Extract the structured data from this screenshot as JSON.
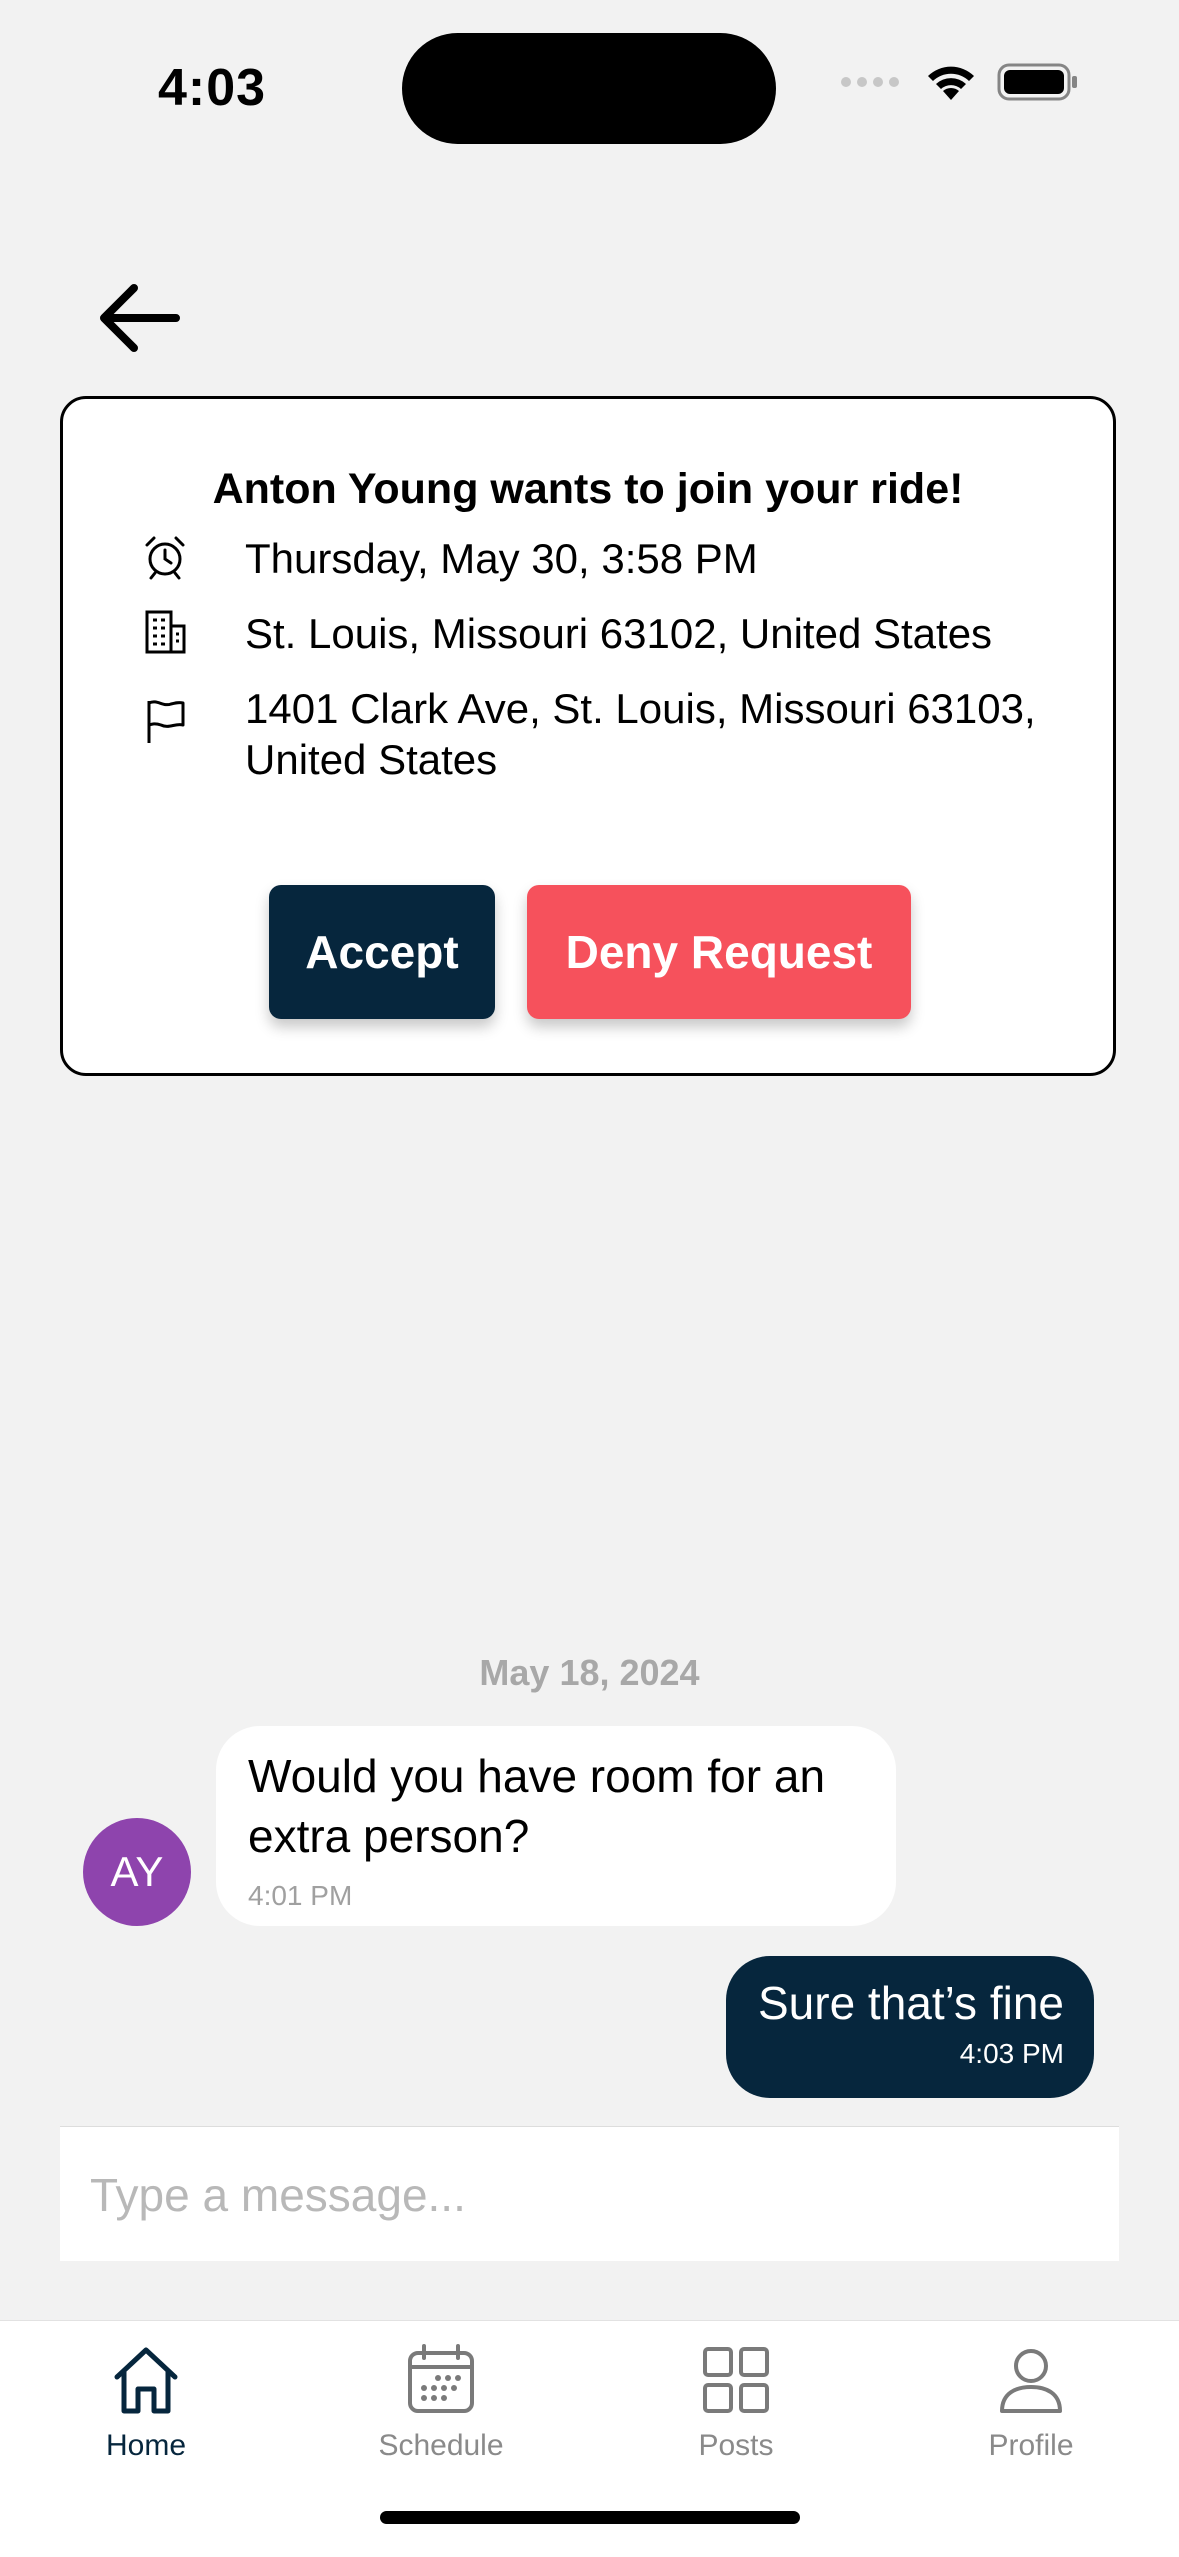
{
  "status_bar": {
    "time": "4:03"
  },
  "request_card": {
    "title": "Anton Young wants to join your ride!",
    "datetime": "Thursday, May 30, 3:58 PM",
    "pickup": "St. Louis, Missouri 63102, United States",
    "dropoff": "1401 Clark Ave, St. Louis, Missouri 63103, United States",
    "accept_label": "Accept",
    "deny_label": "Deny Request",
    "accept_color": "#06263d",
    "deny_color": "#f6515c"
  },
  "chat": {
    "date_separator": "May 18, 2024",
    "messages": [
      {
        "direction": "incoming",
        "avatar_initials": "AY",
        "avatar_color": "#8e44ad",
        "text": "Would you have room for an extra person?",
        "time": "4:01 PM"
      },
      {
        "direction": "outgoing",
        "text": "Sure that’s fine",
        "time": "4:03 PM"
      }
    ]
  },
  "composer": {
    "placeholder": "Type a message...",
    "value": ""
  },
  "tab_bar": {
    "active": "Home",
    "tabs": [
      {
        "label": "Home",
        "icon": "home-icon"
      },
      {
        "label": "Schedule",
        "icon": "calendar-icon"
      },
      {
        "label": "Posts",
        "icon": "grid-icon"
      },
      {
        "label": "Profile",
        "icon": "person-icon"
      }
    ]
  }
}
